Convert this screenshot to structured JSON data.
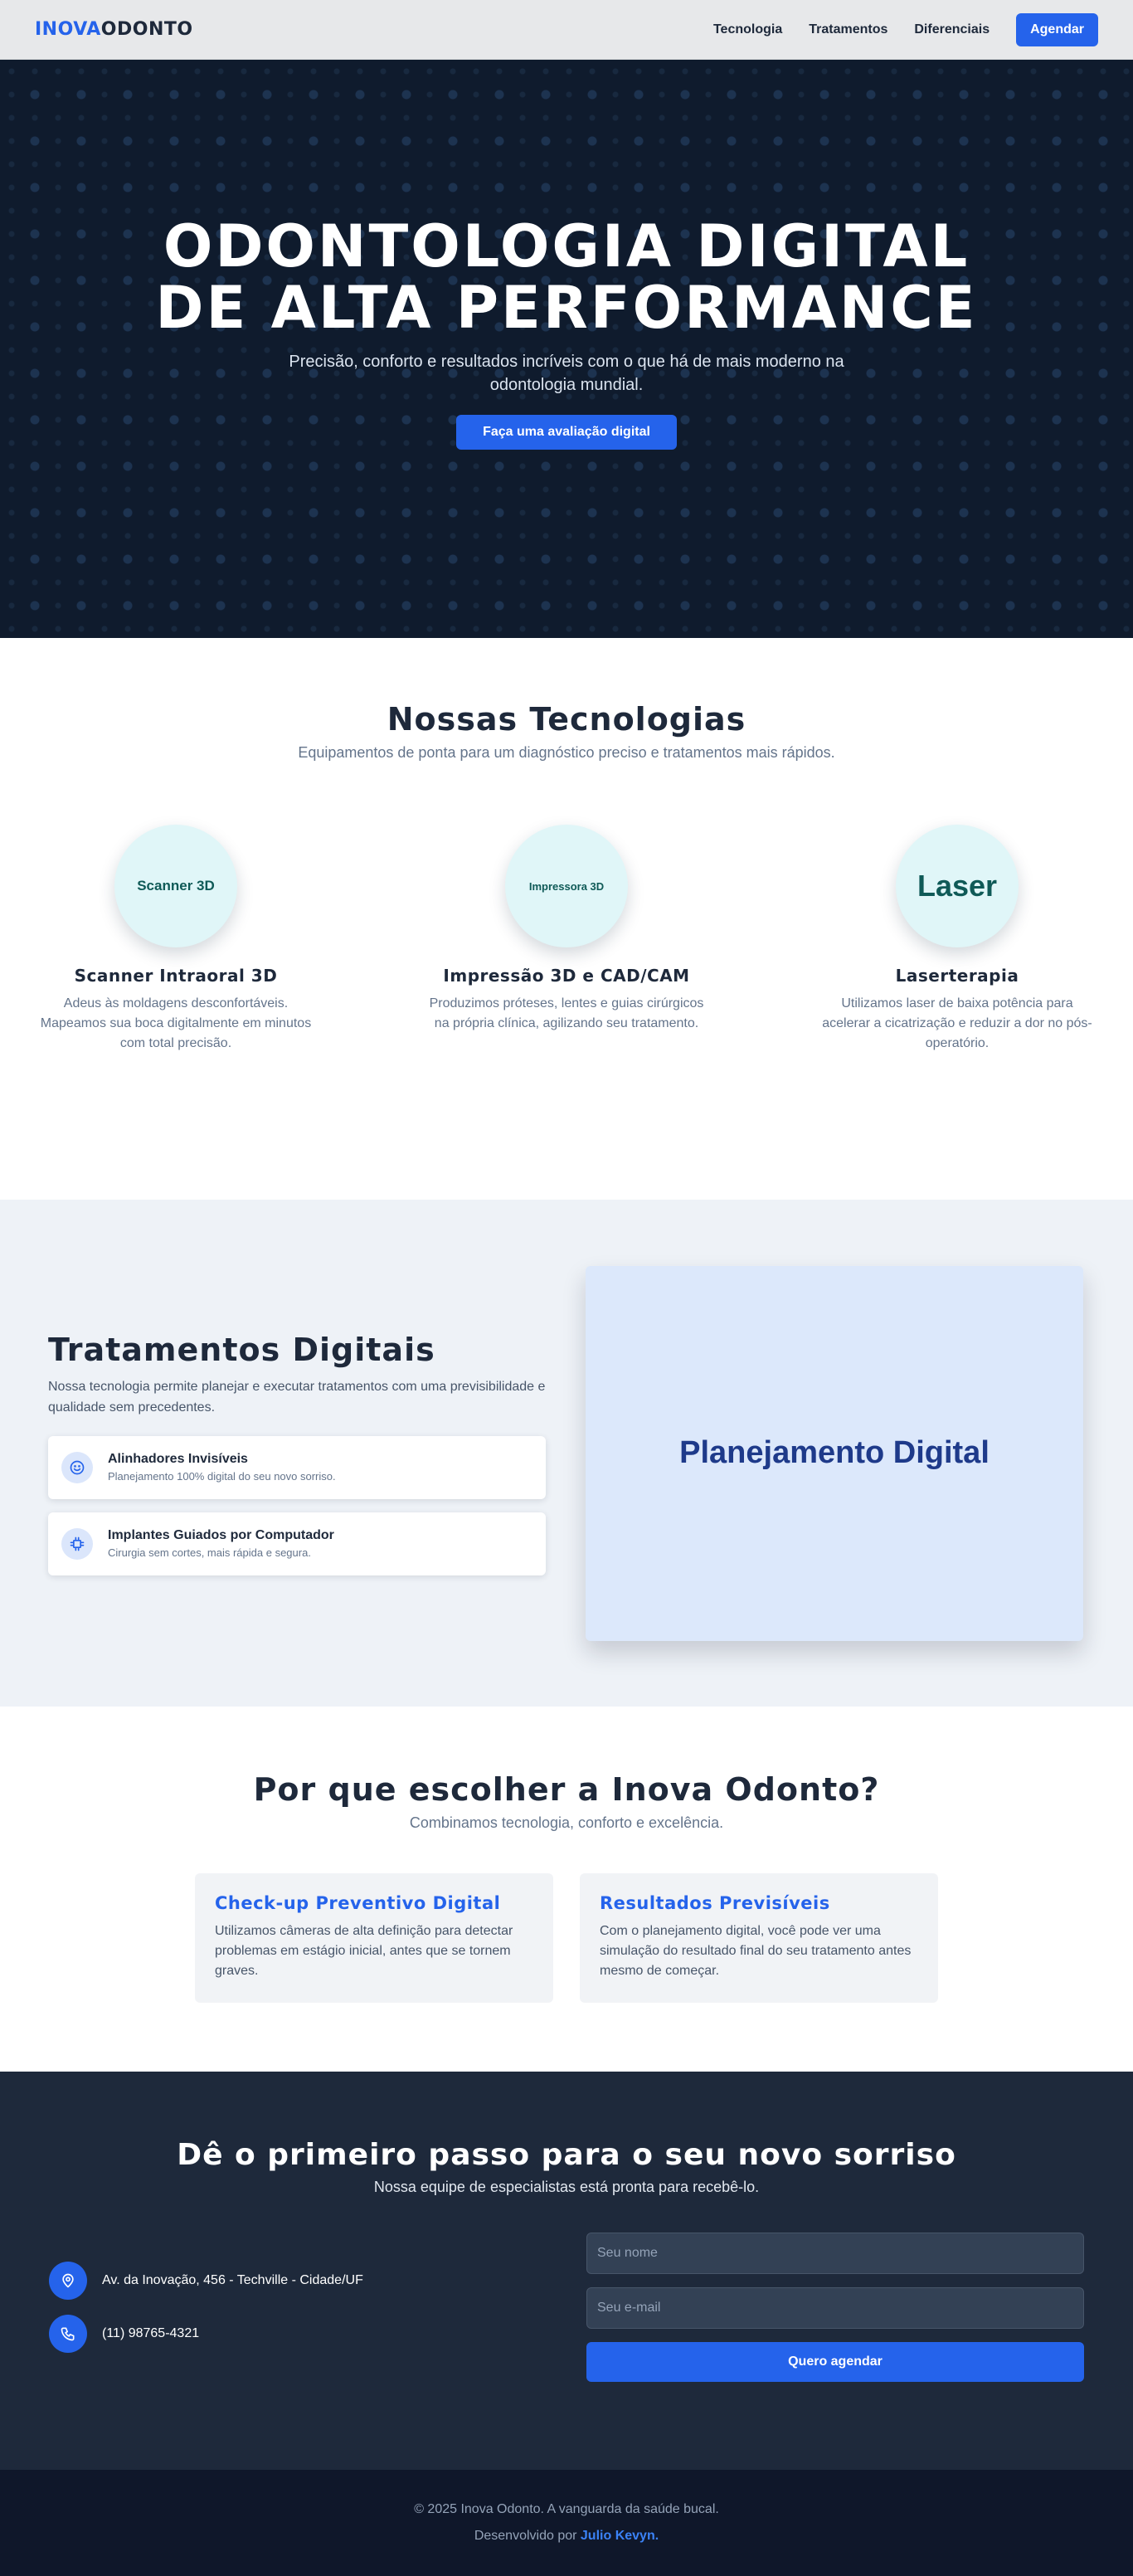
{
  "nav": {
    "logo_part1": "INOVA",
    "logo_part2": "ODONTO",
    "links": [
      "Tecnologia",
      "Tratamentos",
      "Diferenciais"
    ],
    "cta": "Agendar"
  },
  "hero": {
    "title": "ODONTOLOGIA DIGITAL DE ALTA PERFORMANCE",
    "subtitle": "Precisão, conforto e resultados incríveis com o que há de mais moderno na odontologia mundial.",
    "button": "Faça uma avaliação digital"
  },
  "tech": {
    "title": "Nossas Tecnologias",
    "subtitle": "Equipamentos de ponta para um diagnóstico preciso e tratamentos mais rápidos.",
    "items": [
      {
        "badge": "Scanner 3D",
        "name": "Scanner Intraoral 3D",
        "desc": "Adeus às moldagens desconfortáveis. Mapeamos sua boca digitalmente em minutos com total precisão."
      },
      {
        "badge": "Impressora 3D",
        "name": "Impressão 3D e CAD/CAM",
        "desc": "Produzimos próteses, lentes e guias cirúrgicos na própria clínica, agilizando seu tratamento."
      },
      {
        "badge": "Laser",
        "name": "Laserterapia",
        "desc": "Utilizamos laser de baixa potência para acelerar a cicatrização e reduzir a dor no pós-operatório."
      }
    ]
  },
  "treatments": {
    "title": "Tratamentos Digitais",
    "subtitle": "Nossa tecnologia permite planejar e executar tratamentos com uma previsibilidade e qualidade sem precedentes.",
    "cards": [
      {
        "title": "Alinhadores Invisíveis",
        "desc": "Planejamento 100% digital do seu novo sorriso.",
        "icon": "smile-icon"
      },
      {
        "title": "Implantes Guiados por Computador",
        "desc": "Cirurgia sem cortes, mais rápida e segura.",
        "icon": "chip-icon"
      }
    ],
    "image_label": "Planejamento Digital"
  },
  "why": {
    "title": "Por que escolher a Inova Odonto?",
    "subtitle": "Combinamos tecnologia, conforto e excelência.",
    "cards": [
      {
        "title": "Check-up Preventivo Digital",
        "desc": "Utilizamos câmeras de alta definição para detectar problemas em estágio inicial, antes que se tornem graves."
      },
      {
        "title": "Resultados Previsíveis",
        "desc": "Com o planejamento digital, você pode ver uma simulação do resultado final do seu tratamento antes mesmo de começar."
      }
    ]
  },
  "contact": {
    "title": "Dê o primeiro passo para o seu novo sorriso",
    "subtitle": "Nossa equipe de especialistas está pronta para recebê-lo.",
    "address": "Av. da Inovação, 456 - Techville - Cidade/UF",
    "phone": "(11) 98765-4321",
    "name_placeholder": "Seu nome",
    "email_placeholder": "Seu e-mail",
    "submit": "Quero agendar"
  },
  "footer": {
    "copyright": "© 2025 Inova Odonto. A vanguarda da saúde bucal.",
    "dev_prefix": "Desenvolvido por ",
    "dev_name": "Julio Kevyn."
  },
  "colors": {
    "accent": "#2563eb",
    "hero_bg": "#0f1b2d",
    "dark_bg": "#1e293b",
    "footer_bg": "#0f172a"
  }
}
